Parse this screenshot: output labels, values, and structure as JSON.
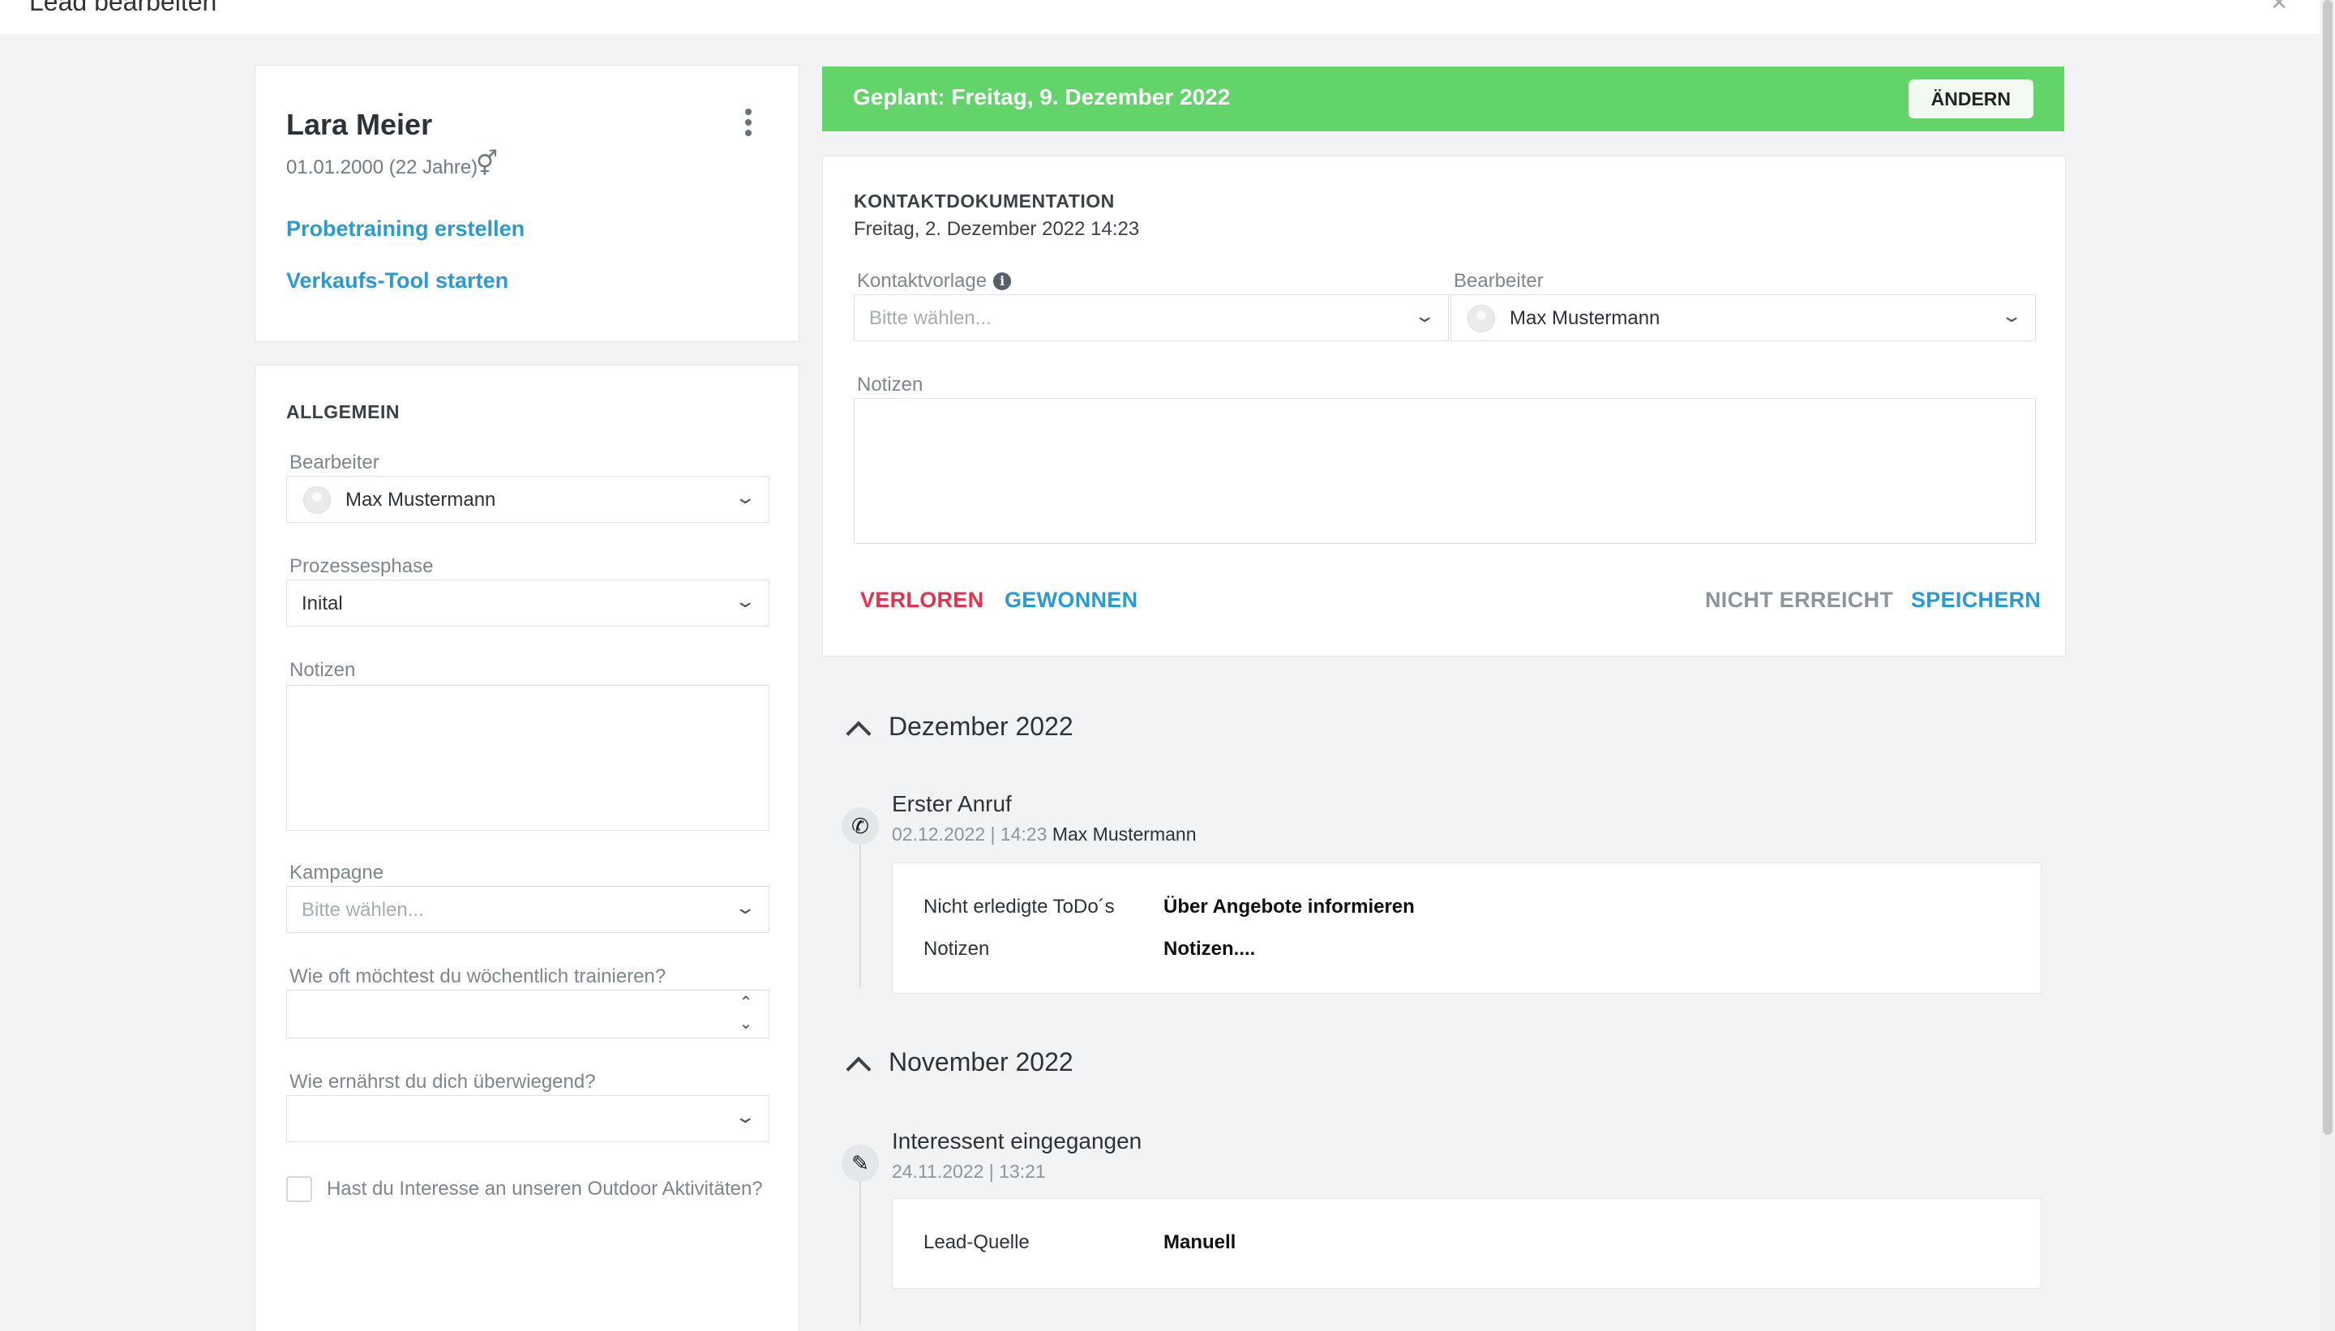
{
  "window": {
    "title": "Lead bearbeiten",
    "close_icon": "close-icon"
  },
  "person": {
    "name": "Lara Meier",
    "dob": "01.01.2000 (22 Jahre)",
    "links": [
      "Probetraining erstellen",
      "Verkaufs-Tool starten"
    ]
  },
  "general": {
    "title": "ALLGEMEIN",
    "editor_label": "Bearbeiter",
    "editor_value": "Max Mustermann",
    "phase_label": "Prozessesphase",
    "phase_value": "Inital",
    "notes_label": "Notizen",
    "campaign_label": "Kampagne",
    "campaign_placeholder": "Bitte wählen...",
    "training_question": "Wie oft möchtest du wöchentlich trainieren?",
    "nutrition_question": "Wie ernährst du dich überwiegend?",
    "outdoor_question": "Hast du Interesse an unseren Outdoor Aktivitäten?"
  },
  "status": {
    "text": "Geplant: Freitag, 9. Dezember 2022",
    "change_label": "ÄNDERN",
    "color": "#62d46a"
  },
  "contact": {
    "title": "KONTAKTDOKUMENTATION",
    "datetime": "Freitag, 2. Dezember 2022 14:23",
    "template_label": "Kontaktvorlage",
    "template_placeholder": "Bitte wählen...",
    "editor_label": "Bearbeiter",
    "editor_value": "Max Mustermann",
    "notes_label": "Notizen",
    "lost_label": "VERLOREN",
    "won_label": "GEWONNEN",
    "not_reached_label": "NICHT ERREICHT",
    "save_label": "SPEICHERN",
    "lost_color": "#e0344f",
    "accent_color": "#2b9ad1"
  },
  "timeline": [
    {
      "month": "Dezember 2022",
      "entries": [
        {
          "icon": "phone-icon",
          "title": "Erster Anruf",
          "date": "02.12.2022 | 14:23",
          "author": "Max Mustermann",
          "details": [
            {
              "key": "Nicht erledigte ToDo´s",
              "value": "Über Angebote informieren"
            },
            {
              "key": "Notizen",
              "value": "Notizen...."
            }
          ]
        }
      ]
    },
    {
      "month": "November 2022",
      "entries": [
        {
          "icon": "edit-icon",
          "title": "Interessent eingegangen",
          "date": "24.11.2022 | 13:21",
          "author": "",
          "details": [
            {
              "key": "Lead-Quelle",
              "value": "Manuell"
            }
          ]
        }
      ]
    }
  ]
}
